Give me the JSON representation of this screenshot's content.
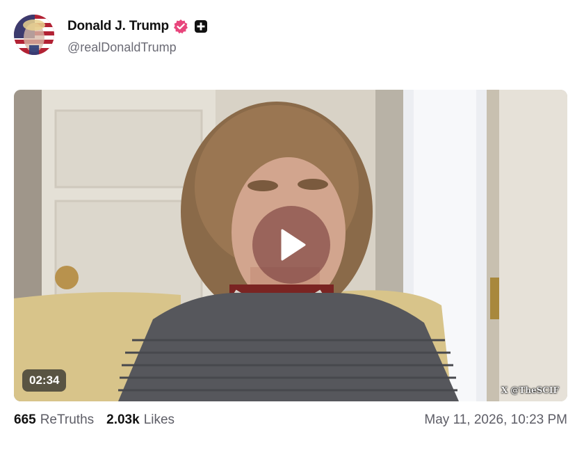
{
  "author": {
    "display_name": "Donald J. Trump",
    "handle": "@realDonaldTrump",
    "verified_icon": "verified-badge-icon",
    "extra_icon": "plus-square-icon"
  },
  "video": {
    "duration": "02:34",
    "watermark": "X @TheSCIF",
    "play_icon": "play-icon"
  },
  "stats": {
    "retruths_count": "665",
    "retruths_label": "ReTruths",
    "likes_count": "2.03k",
    "likes_label": "Likes"
  },
  "timestamp": "May 11, 2026, 10:23 PM",
  "colors": {
    "verified_badge": "#e8467c",
    "text_secondary": "#5d5d66"
  }
}
